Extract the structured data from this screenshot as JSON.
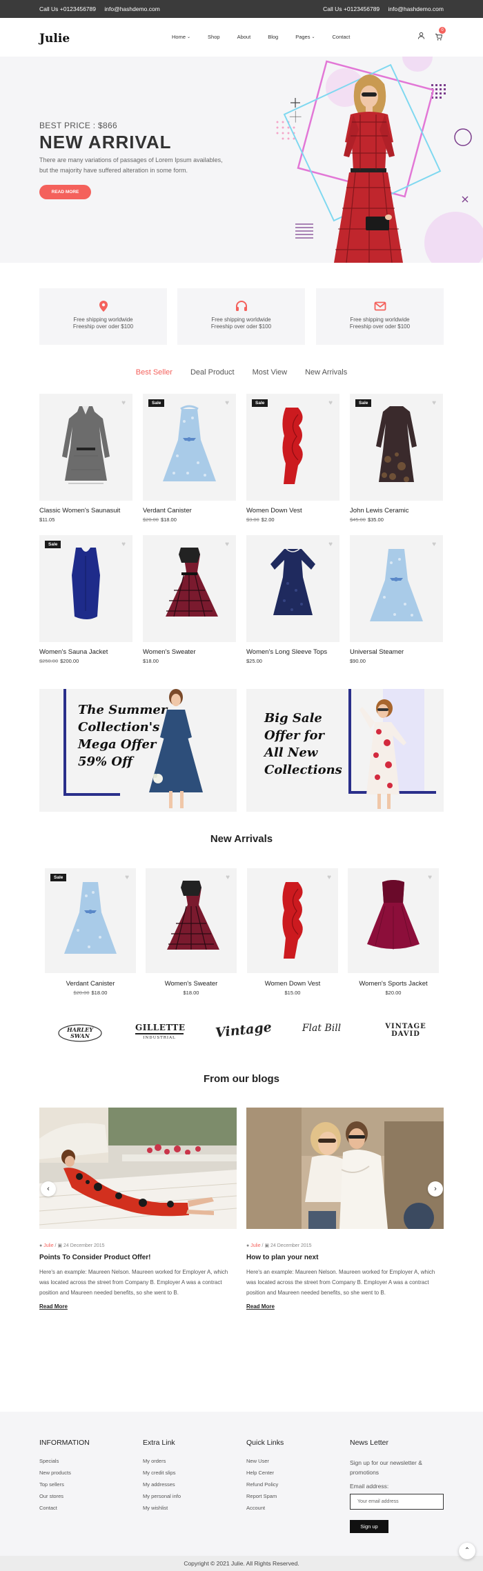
{
  "topbar": {
    "left_phone": "Call Us +0123456789",
    "left_email": "info@hashdemo.com",
    "right_phone": "Call Us +0123456789",
    "right_email": "info@hashdemo.com"
  },
  "header": {
    "logo": "Julie",
    "nav": [
      "Home",
      "Shop",
      "About",
      "Blog",
      "Pages",
      "Contact"
    ],
    "cart_count": "0"
  },
  "hero": {
    "price": "BEST PRICE : $866",
    "title": "NEW ARRIVAL",
    "desc": "There are many variations of passages of Lorem Ipsum availables, but the majority have suffered alteration in some form.",
    "button": "READ MORE"
  },
  "features": [
    {
      "icon": "map-pin-icon",
      "title": "Free shipping worldwide",
      "sub": "Freeship over oder $100"
    },
    {
      "icon": "headphones-icon",
      "title": "Free shipping worldwide",
      "sub": "Freeship over oder $100"
    },
    {
      "icon": "mail-icon",
      "title": "Free shipping worldwide",
      "sub": "Freeship over oder $100"
    }
  ],
  "tabs": [
    "Best Seller",
    "Deal Product",
    "Most View",
    "New Arrivals"
  ],
  "products": [
    {
      "name": "Classic Women's Saunasuit",
      "old": "",
      "price": "$11.05",
      "sale": ""
    },
    {
      "name": "Verdant Canister",
      "old": "$20.00",
      "price": "$18.00",
      "sale": "Sale"
    },
    {
      "name": "Women Down Vest",
      "old": "$3.00",
      "price": "$2.00",
      "sale": "Sale"
    },
    {
      "name": "John Lewis Ceramic",
      "old": "$45.00",
      "price": "$35.00",
      "sale": "Sale"
    },
    {
      "name": "Women's Sauna Jacket",
      "old": "$250.00",
      "price": "$200.00",
      "sale": "Sale"
    },
    {
      "name": "Women's Sweater",
      "old": "",
      "price": "$18.00",
      "sale": ""
    },
    {
      "name": "Women's Long Sleeve Tops",
      "old": "",
      "price": "$25.00",
      "sale": ""
    },
    {
      "name": "Universal Steamer",
      "old": "",
      "price": "$90.00",
      "sale": ""
    }
  ],
  "banners": [
    {
      "lines": [
        "The Summer",
        "Collection's",
        "Mega Offer",
        "59% Off"
      ]
    },
    {
      "lines": [
        "Big Sale",
        "Offer for",
        "All New",
        "Collections"
      ]
    }
  ],
  "new_arrivals": {
    "title": "New Arrivals",
    "items": [
      {
        "name": "Verdant Canister",
        "old": "$20.00",
        "price": "$18.00",
        "sale": "Sale"
      },
      {
        "name": "Women's Sweater",
        "old": "",
        "price": "$18.00",
        "sale": ""
      },
      {
        "name": "Women Down Vest",
        "old": "",
        "price": "$15.00",
        "sale": ""
      },
      {
        "name": "Women's Sports Jacket",
        "old": "",
        "price": "$20.00",
        "sale": ""
      }
    ]
  },
  "brands": [
    "HARLEY SWAN",
    "GILLETTE",
    "INDUSTRIAL",
    "Vintage",
    "Flat Bill",
    "VINTAGE DAVID"
  ],
  "blogs": {
    "title": "From our blogs",
    "posts": [
      {
        "author": "Julie",
        "date": "24 December 2015",
        "title": "Points To Consider Product Offer!",
        "desc": "Here's an example: Maureen Nelson. Maureen worked for Employer A, which was located across the street from Company B. Employer A was a contract position and Maureen needed benefits, so she went to B.",
        "more": "Read More"
      },
      {
        "author": "Julie",
        "date": "24 December 2015",
        "title": "How to plan your next",
        "desc": "Here's an example: Maureen Nelson. Maureen worked for Employer A, which was located across the street from Company B. Employer A was a contract position and Maureen needed benefits, so she went to B.",
        "more": "Read More"
      }
    ]
  },
  "footer": {
    "info": {
      "title": "INFORMATION",
      "items": [
        "Specials",
        "New products",
        "Top sellers",
        "Our stores",
        "Contact"
      ]
    },
    "extra": {
      "title": "Extra Link",
      "items": [
        "My orders",
        "My credit slips",
        "My addresses",
        "My personal info",
        "My wishlist"
      ]
    },
    "quick": {
      "title": "Quick Links",
      "items": [
        "New User",
        "Help Center",
        "Refund Policy",
        "Report Spam",
        "Account"
      ]
    },
    "news": {
      "title": "News Letter",
      "text": "Sign up for our newsletter & promotions",
      "label": "Email address:",
      "placeholder": "Your email address",
      "button": "Sign up"
    }
  },
  "copyright": "Copyright © 2021 Julie. All Rights Reserved."
}
